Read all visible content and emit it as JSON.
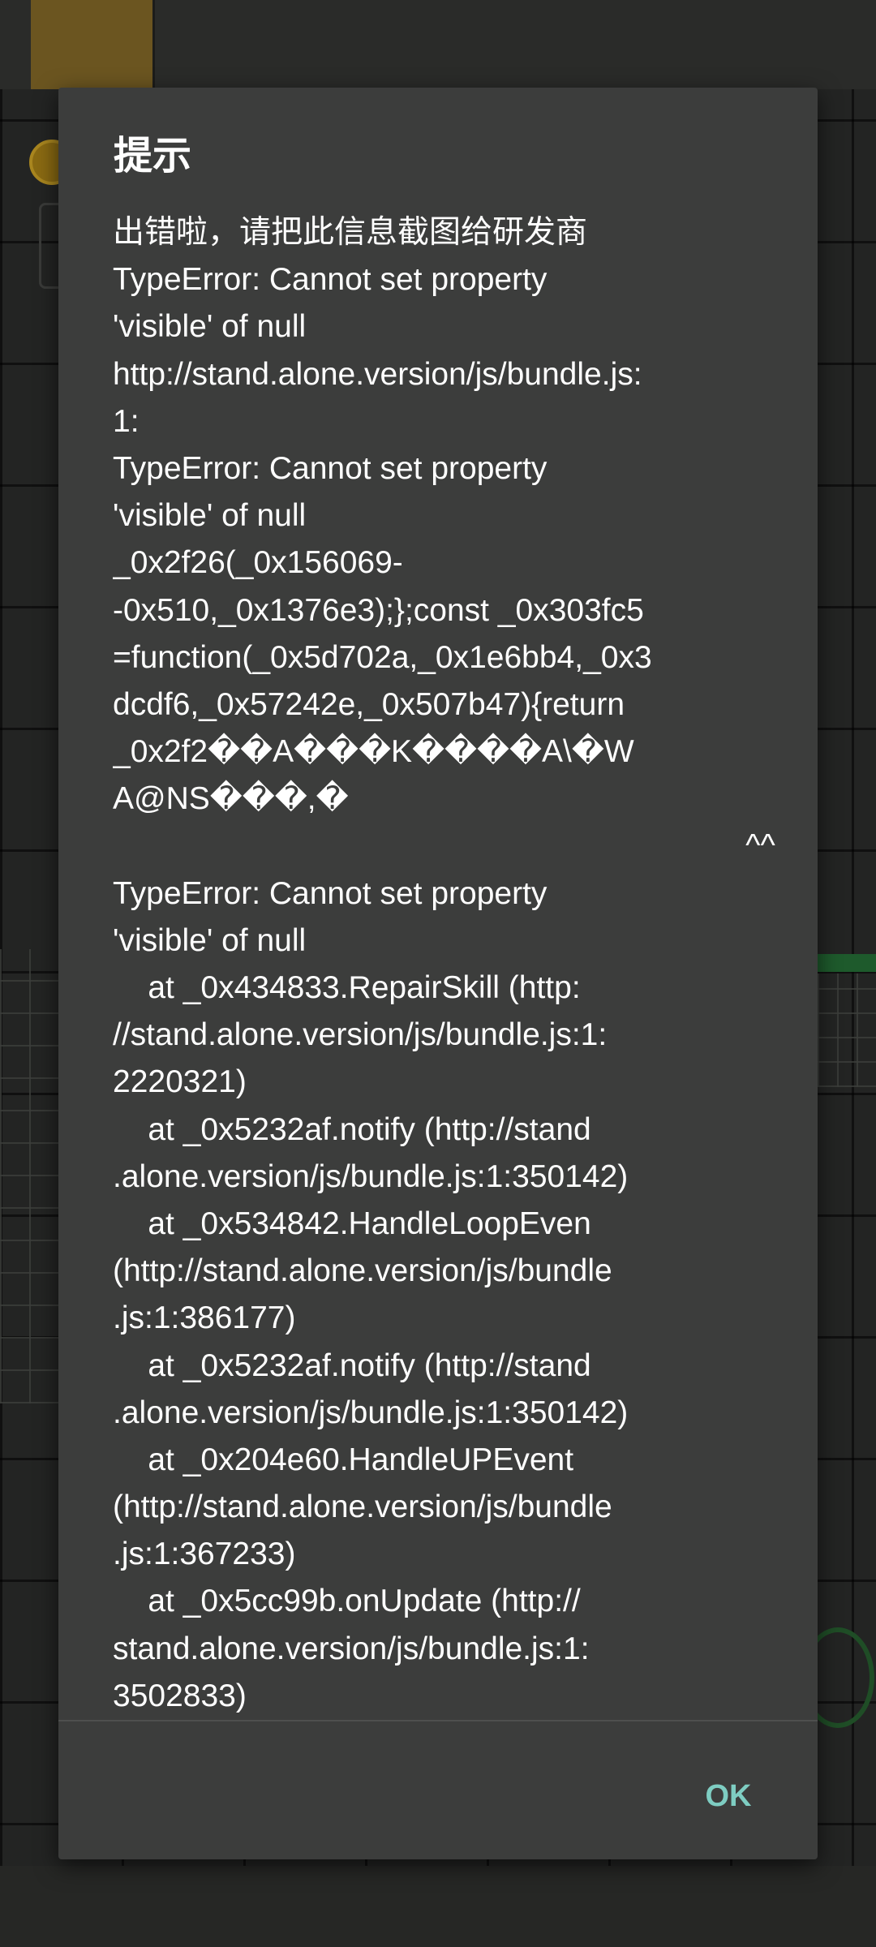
{
  "dialog": {
    "title": "提示",
    "message_lines": [
      "出错啦，请把此信息截图给研发商",
      "TypeError: Cannot set property",
      "'visible' of null",
      "http://stand.alone.version/js/bundle.js:",
      "1:",
      "TypeError: Cannot set property",
      "'visible' of null",
      "_0x2f26(_0x156069-",
      "-0x510,_0x1376e3);};const _0x303fc5",
      "=function(_0x5d702a,_0x1e6bb4,_0x3",
      "dcdf6,_0x57242e,_0x507b47){return",
      "_0x2f2��A���K����A\\�W",
      "A@NS���,�",
      "                                                                        ^^",
      "TypeError: Cannot set property",
      "'visible' of null",
      "    at _0x434833.RepairSkill (http:",
      "//stand.alone.version/js/bundle.js:1:",
      "2220321)",
      "    at _0x5232af.notify (http://stand",
      ".alone.version/js/bundle.js:1:350142)",
      "    at _0x534842.HandleLoopEven",
      "(http://stand.alone.version/js/bundle",
      ".js:1:386177)",
      "    at _0x5232af.notify (http://stand",
      ".alone.version/js/bundle.js:1:350142)",
      "    at _0x204e60.HandleUPEvent",
      "(http://stand.alone.version/js/bundle",
      ".js:1:367233)",
      "    at _0x5cc99b.onUpdate (http://",
      "stand.alone.version/js/bundle.js:1:",
      "3502833)"
    ],
    "ok_label": "OK",
    "colors": {
      "dialog_bg": "#3c3d3c",
      "title_text": "#ffffff",
      "message_text": "#ffffff",
      "button_text": "#7ecdc2"
    }
  }
}
